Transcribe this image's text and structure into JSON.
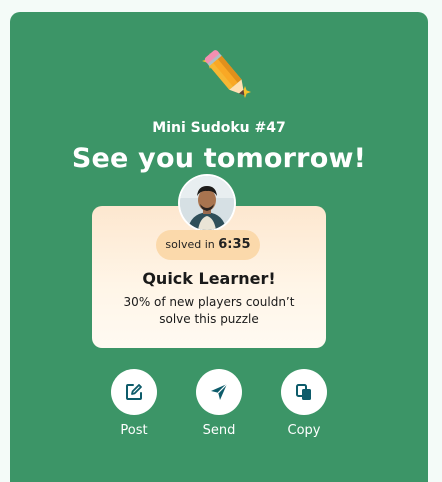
{
  "header": {
    "icon": "pencil-sparkles-icon",
    "puzzle_name": "Mini Sudoku #47",
    "headline": "See you tomorrow!"
  },
  "result_card": {
    "solved_prefix": "solved in",
    "solved_time": "6:35",
    "title": "Quick Learner!",
    "description": "30% of new players couldn’t solve this puzzle"
  },
  "actions": [
    {
      "label": "Post",
      "icon": "edit-icon"
    },
    {
      "label": "Send",
      "icon": "send-icon"
    },
    {
      "label": "Copy",
      "icon": "copy-icon"
    }
  ],
  "colors": {
    "panel_green": "#3c9567",
    "card_gradient_top": "#fde7cf",
    "pill": "#fbd9ab",
    "icon_teal": "#0d5b6a"
  }
}
